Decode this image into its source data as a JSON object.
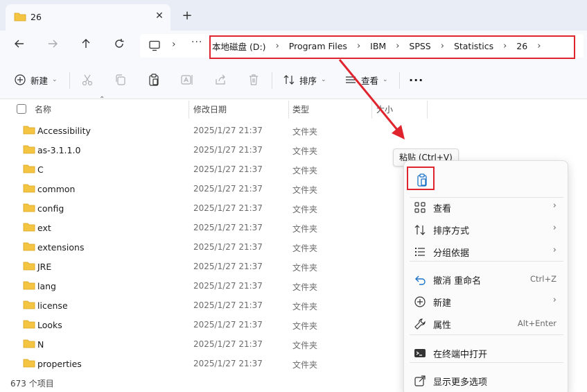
{
  "tab": {
    "title": "26",
    "close": "✕",
    "new": "+"
  },
  "nav": {
    "more": "···"
  },
  "address": {
    "crumbs": [
      "本地磁盘 (D:)",
      "Program Files",
      "IBM",
      "SPSS",
      "Statistics",
      "26"
    ],
    "separator": "›"
  },
  "toolbar": {
    "new_label": "新建",
    "sort_label": "排序",
    "view_label": "查看",
    "more": "···"
  },
  "columns": {
    "name": "名称",
    "date": "修改日期",
    "type": "类型",
    "size": "大小"
  },
  "files": [
    {
      "name": "Accessibility",
      "date": "2025/1/27 21:37",
      "type": "文件夹"
    },
    {
      "name": "as-3.1.1.0",
      "date": "2025/1/27 21:37",
      "type": "文件夹"
    },
    {
      "name": "C",
      "date": "2025/1/27 21:37",
      "type": "文件夹"
    },
    {
      "name": "common",
      "date": "2025/1/27 21:37",
      "type": "文件夹"
    },
    {
      "name": "config",
      "date": "2025/1/27 21:37",
      "type": "文件夹"
    },
    {
      "name": "ext",
      "date": "2025/1/27 21:37",
      "type": "文件夹"
    },
    {
      "name": "extensions",
      "date": "2025/1/27 21:37",
      "type": "文件夹"
    },
    {
      "name": "JRE",
      "date": "2025/1/27 21:37",
      "type": "文件夹"
    },
    {
      "name": "lang",
      "date": "2025/1/27 21:37",
      "type": "文件夹"
    },
    {
      "name": "license",
      "date": "2025/1/27 21:37",
      "type": "文件夹"
    },
    {
      "name": "Looks",
      "date": "2025/1/27 21:37",
      "type": "文件夹"
    },
    {
      "name": "N",
      "date": "2025/1/27 21:37",
      "type": "文件夹"
    },
    {
      "name": "properties",
      "date": "2025/1/27 21:37",
      "type": "文件夹"
    }
  ],
  "status": {
    "count": "673 个项目"
  },
  "context_menu": {
    "tooltip": "粘贴 (Ctrl+V)",
    "items": [
      {
        "label": "查看",
        "icon": "grid-icon",
        "submenu": "›"
      },
      {
        "label": "排序方式",
        "icon": "sort-icon",
        "submenu": "›"
      },
      {
        "label": "分组依据",
        "icon": "group-list-icon",
        "submenu": "›"
      },
      {
        "label": "撤消 重命名",
        "icon": "undo-icon",
        "shortcut": "Ctrl+Z"
      },
      {
        "label": "新建",
        "icon": "plus-circle-icon",
        "submenu": "›"
      },
      {
        "label": "属性",
        "icon": "wrench-icon",
        "shortcut": "Alt+Enter"
      },
      {
        "label": "在终端中打开",
        "icon": "terminal-icon"
      },
      {
        "label": "显示更多选项",
        "icon": "share-icon"
      }
    ]
  },
  "colors": {
    "annotation_red": "#e0242e",
    "folder_yellow": "#f4c542",
    "accent_blue": "#1a73c9"
  }
}
